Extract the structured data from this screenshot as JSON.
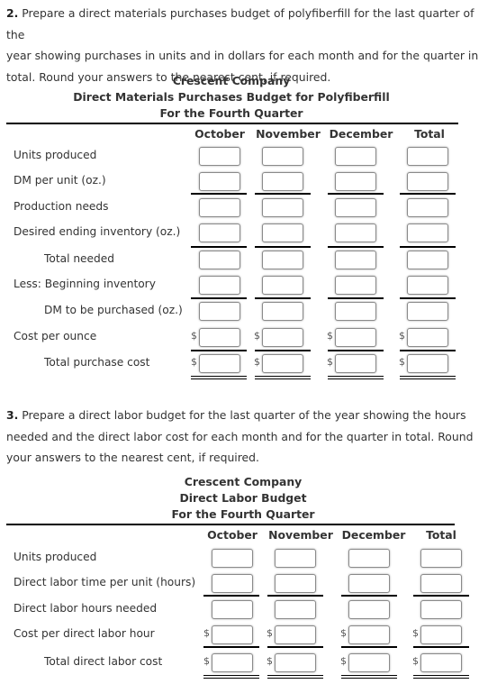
{
  "question2": {
    "number": "2.",
    "text_lines": [
      "Prepare a direct materials purchases budget of polyfiberfill for the last quarter of the",
      "year showing purchases in units and in dollars for each month and for the quarter in",
      "total. Round your answers to the nearest cent, if required."
    ],
    "header": {
      "company": "Crescent Company",
      "title": "Direct Materials Purchases Budget for Polyfiberfill",
      "period": "For the Fourth Quarter"
    },
    "columns": [
      "October",
      "November",
      "December",
      "Total"
    ],
    "rows": [
      {
        "label": "Units produced",
        "indent": false,
        "currency": false,
        "values": [
          "",
          "",
          "",
          ""
        ]
      },
      {
        "label": "DM per unit (oz.)",
        "indent": false,
        "currency": false,
        "values": [
          "",
          "",
          "",
          ""
        ]
      },
      {
        "label": "Production needs",
        "indent": false,
        "currency": false,
        "values": [
          "",
          "",
          "",
          ""
        ]
      },
      {
        "label": "Desired ending inventory (oz.)",
        "indent": false,
        "currency": false,
        "values": [
          "",
          "",
          "",
          ""
        ]
      },
      {
        "label": "Total needed",
        "indent": true,
        "currency": false,
        "values": [
          "",
          "",
          "",
          ""
        ]
      },
      {
        "label": "Less: Beginning inventory",
        "indent": false,
        "currency": false,
        "values": [
          "",
          "",
          "",
          ""
        ]
      },
      {
        "label": "DM to be purchased (oz.)",
        "indent": true,
        "currency": false,
        "values": [
          "",
          "",
          "",
          ""
        ]
      },
      {
        "label": "Cost per ounce",
        "indent": false,
        "currency": true,
        "values": [
          "",
          "",
          "",
          ""
        ]
      },
      {
        "label": "Total purchase cost",
        "indent": true,
        "currency": true,
        "values": [
          "",
          "",
          "",
          ""
        ]
      }
    ],
    "currency_symbol": "$"
  },
  "question3": {
    "number": "3.",
    "text_lines": [
      "Prepare a direct labor budget for the last quarter of the year showing the hours",
      "needed and the direct labor cost for each month and for the quarter in total. Round",
      "your answers to the nearest cent, if required."
    ],
    "header": {
      "company": "Crescent Company",
      "title": "Direct Labor Budget",
      "period": "For the Fourth Quarter"
    },
    "columns": [
      "October",
      "November",
      "December",
      "Total"
    ],
    "rows": [
      {
        "label": "Units produced",
        "indent": false,
        "currency": false,
        "values": [
          "",
          "",
          "",
          ""
        ]
      },
      {
        "label": "Direct labor time per unit (hours)",
        "indent": false,
        "currency": false,
        "values": [
          "",
          "",
          "",
          ""
        ]
      },
      {
        "label": "Direct labor hours needed",
        "indent": false,
        "currency": false,
        "values": [
          "",
          "",
          "",
          ""
        ]
      },
      {
        "label": "Cost per direct labor hour",
        "indent": false,
        "currency": true,
        "values": [
          "",
          "",
          "",
          ""
        ]
      },
      {
        "label": "Total direct labor cost",
        "indent": true,
        "currency": true,
        "values": [
          "",
          "",
          "",
          ""
        ]
      }
    ],
    "currency_symbol": "$"
  }
}
